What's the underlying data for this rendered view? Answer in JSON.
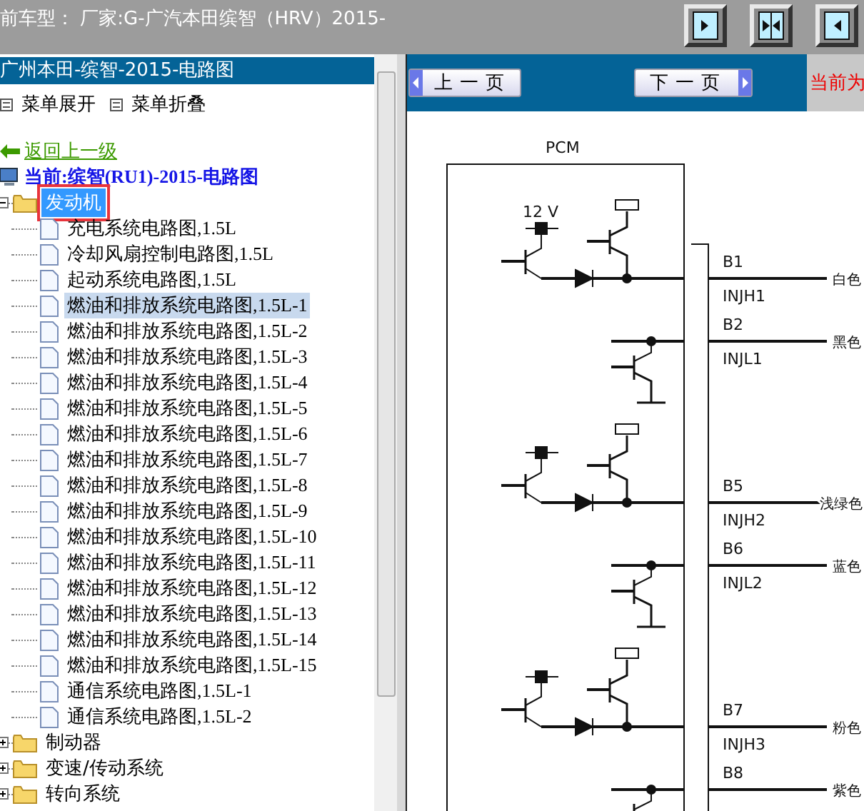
{
  "header": {
    "car_model_label": "前车型：",
    "car_model": "厂家:G-广汽本田缤智（HRV）2015-"
  },
  "left_panel": {
    "title": "广州本田-缤智-2015-电路图",
    "menu_actions": [
      "菜单展开",
      "菜单折叠"
    ]
  },
  "tree": {
    "back_link": "返回上一级",
    "current": "当前:缤智(RU1)-2015-电路图",
    "nodes": [
      {
        "label": "发动机",
        "expanded": true,
        "selected": true,
        "children": [
          {
            "label": "充电系统电路图,1.5L",
            "selected": false
          },
          {
            "label": "冷却风扇控制电路图,1.5L",
            "selected": false
          },
          {
            "label": "起动系统电路图,1.5L",
            "selected": false
          },
          {
            "label": "燃油和排放系统电路图,1.5L-1",
            "selected": true
          },
          {
            "label": "燃油和排放系统电路图,1.5L-2",
            "selected": false
          },
          {
            "label": "燃油和排放系统电路图,1.5L-3",
            "selected": false
          },
          {
            "label": "燃油和排放系统电路图,1.5L-4",
            "selected": false
          },
          {
            "label": "燃油和排放系统电路图,1.5L-5",
            "selected": false
          },
          {
            "label": "燃油和排放系统电路图,1.5L-6",
            "selected": false
          },
          {
            "label": "燃油和排放系统电路图,1.5L-7",
            "selected": false
          },
          {
            "label": "燃油和排放系统电路图,1.5L-8",
            "selected": false
          },
          {
            "label": "燃油和排放系统电路图,1.5L-9",
            "selected": false
          },
          {
            "label": "燃油和排放系统电路图,1.5L-10",
            "selected": false
          },
          {
            "label": "燃油和排放系统电路图,1.5L-11",
            "selected": false
          },
          {
            "label": "燃油和排放系统电路图,1.5L-12",
            "selected": false
          },
          {
            "label": "燃油和排放系统电路图,1.5L-13",
            "selected": false
          },
          {
            "label": "燃油和排放系统电路图,1.5L-14",
            "selected": false
          },
          {
            "label": "燃油和排放系统电路图,1.5L-15",
            "selected": false
          },
          {
            "label": "通信系统电路图,1.5L-1",
            "selected": false
          },
          {
            "label": "通信系统电路图,1.5L-2",
            "selected": false
          }
        ]
      },
      {
        "label": "制动器",
        "expanded": false,
        "selected": false
      },
      {
        "label": "变速/传动系统",
        "expanded": false,
        "selected": false
      },
      {
        "label": "转向系统",
        "expanded": false,
        "selected": false
      }
    ]
  },
  "pager": {
    "prev": "上一页",
    "next": "下一页",
    "current_label": "当前为"
  },
  "diagram": {
    "module": "PCM",
    "voltage": "12 V",
    "pins": [
      {
        "pin": "B1",
        "signal": "INJH1",
        "wire": "白色",
        "kind": "high"
      },
      {
        "pin": "B2",
        "signal": "INJL1",
        "wire": "黑色",
        "kind": "low"
      },
      {
        "pin": "B5",
        "signal": "INJH2",
        "wire": "浅绿色",
        "kind": "high"
      },
      {
        "pin": "B6",
        "signal": "INJL2",
        "wire": "蓝色",
        "kind": "low"
      },
      {
        "pin": "B7",
        "signal": "INJH3",
        "wire": "粉色",
        "kind": "high"
      },
      {
        "pin": "B8",
        "wire": "紫色",
        "kind": "low"
      }
    ]
  }
}
